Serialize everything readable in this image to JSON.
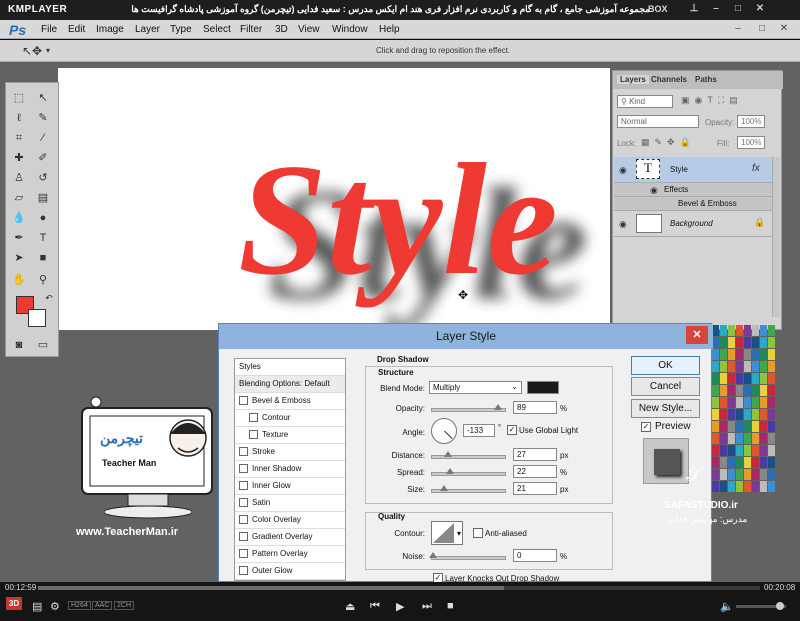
{
  "player": {
    "logo": "KMPLAYER",
    "title": "مجموعه آموزشی جامع ، گام به گام و کاربردی نرم افزار فری هند ام ایکس   مدرس : سعید فدایی (تیچرمن) گروه آموزشی پادشاه گرافیست ها",
    "box_label": "BOX",
    "time_elapsed": "00:12:59",
    "time_total": "00:20:08",
    "badges": [
      "3D",
      "H264",
      "AAC",
      "2CH"
    ]
  },
  "menubar": {
    "logo": "Ps",
    "items": [
      "File",
      "Edit",
      "Image",
      "Layer",
      "Type",
      "Select",
      "Filter",
      "3D",
      "View",
      "Window",
      "Help"
    ]
  },
  "options_bar": {
    "hint": "Click and drag to reposition the effect."
  },
  "canvas": {
    "text": "Style",
    "text_color": "#ef3a34"
  },
  "layers_panel": {
    "tabs": [
      "Layers",
      "Channels",
      "Paths"
    ],
    "kind_filter": "Kind",
    "blend_mode": "Normal",
    "opacity_label": "Opacity:",
    "opacity_value": "100%",
    "lock_label": "Lock:",
    "fill_label": "Fill:",
    "fill_value": "100%",
    "layers": [
      {
        "name": "Style",
        "type": "text",
        "fx": "fx"
      },
      {
        "name": "Effects",
        "type": "effects-group"
      },
      {
        "name": "Bevel & Emboss",
        "type": "effect"
      },
      {
        "name": "Background",
        "type": "background"
      }
    ]
  },
  "layer_style_dialog": {
    "title": "Layer Style",
    "styles_header": "Styles",
    "styles": [
      {
        "label": "Blending Options: Default",
        "checkbox": false
      },
      {
        "label": "Bevel & Emboss",
        "checkbox": true
      },
      {
        "label": "Contour",
        "checkbox": true
      },
      {
        "label": "Texture",
        "checkbox": true
      },
      {
        "label": "Stroke",
        "checkbox": true
      },
      {
        "label": "Inner Shadow",
        "checkbox": true
      },
      {
        "label": "Inner Glow",
        "checkbox": true
      },
      {
        "label": "Satin",
        "checkbox": true
      },
      {
        "label": "Color Overlay",
        "checkbox": true
      },
      {
        "label": "Gradient Overlay",
        "checkbox": true
      },
      {
        "label": "Pattern Overlay",
        "checkbox": true
      },
      {
        "label": "Outer Glow",
        "checkbox": true
      }
    ],
    "drop_shadow": {
      "title": "Drop Shadow",
      "structure_title": "Structure",
      "blend_mode_label": "Blend Mode:",
      "blend_mode_value": "Multiply",
      "shadow_color": "#1a1a1a",
      "opacity_label": "Opacity:",
      "opacity_value": "89",
      "opacity_unit": "%",
      "angle_label": "Angle:",
      "angle_value": "-133",
      "angle_unit": "°",
      "use_global_light": "Use Global Light",
      "distance_label": "Distance:",
      "distance_value": "27",
      "distance_unit": "px",
      "spread_label": "Spread:",
      "spread_value": "22",
      "spread_unit": "%",
      "size_label": "Size:",
      "size_value": "21",
      "size_unit": "px",
      "quality_title": "Quality",
      "contour_label": "Contour:",
      "anti_aliased": "Anti-aliased",
      "noise_label": "Noise:",
      "noise_value": "0",
      "noise_unit": "%",
      "knockout": "Layer Knocks Out Drop Shadow"
    },
    "buttons": {
      "ok": "OK",
      "cancel": "Cancel",
      "new_style": "New Style...",
      "preview": "Preview"
    }
  },
  "watermark": {
    "brand_fa": "تیچرمن",
    "brand_en": "Teacher Man",
    "url": "www.TeacherMan.ir",
    "studio": "SAFASTUDIO.ir",
    "instructor": "مدرس: مهندس فدایی"
  },
  "colors": {
    "accent_red": "#ef3a34",
    "dialog_title_bg": "#8fb4dc",
    "player_bg": "#151515"
  }
}
